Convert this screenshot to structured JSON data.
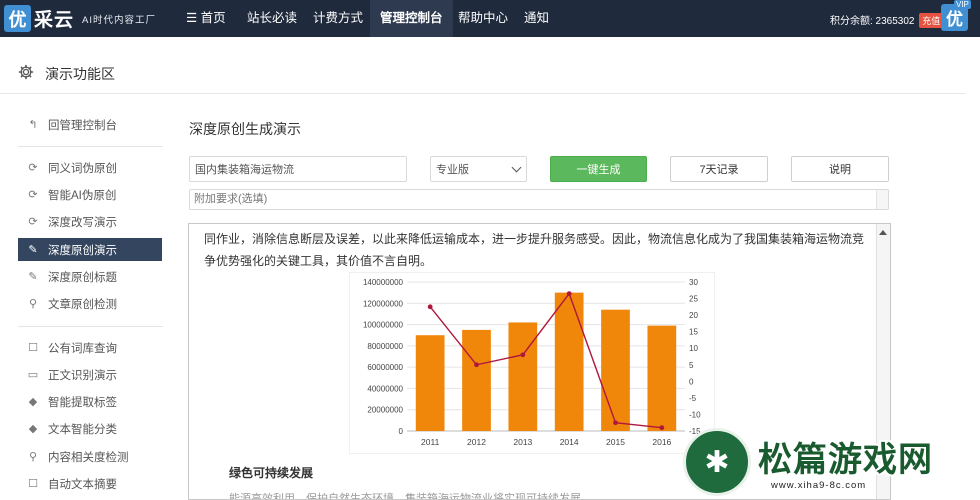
{
  "app": {
    "logo_char": "优",
    "logo_name": "采云",
    "slogan": "AI时代内容工厂"
  },
  "nav": [
    {
      "label": "☰ 首页",
      "active": false
    },
    {
      "label": "站长必读",
      "active": false
    },
    {
      "label": "计费方式",
      "active": false
    },
    {
      "label": "管理控制台",
      "active": true
    },
    {
      "label": "帮助中心",
      "active": false
    },
    {
      "label": "通知",
      "active": false
    }
  ],
  "account": {
    "balance_text": "积分余额: 2365302",
    "recharge_label": "充值",
    "avatar_char": "优",
    "vip_label": "VIP"
  },
  "page": {
    "title": "演示功能区"
  },
  "sidebar": {
    "items": [
      {
        "label": "回管理控制台",
        "icon": "↰",
        "icon_name": "back-icon"
      },
      {
        "label": "同义词伪原创",
        "icon": "⟳",
        "icon_name": "refresh-icon"
      },
      {
        "label": "智能AI伪原创",
        "icon": "⟳",
        "icon_name": "refresh-icon"
      },
      {
        "label": "深度改写演示",
        "icon": "⟳",
        "icon_name": "refresh-icon"
      },
      {
        "label": "深度原创演示",
        "icon": "✎",
        "icon_name": "edit-icon"
      },
      {
        "label": "深度原创标题",
        "icon": "✎",
        "icon_name": "edit-icon"
      },
      {
        "label": "文章原创检测",
        "icon": "⚲",
        "icon_name": "search-icon"
      },
      {
        "label": "公有词库查询",
        "icon": "☐",
        "icon_name": "book-icon"
      },
      {
        "label": "正文识别演示",
        "icon": "▭",
        "icon_name": "monitor-icon"
      },
      {
        "label": "智能提取标签",
        "icon": "◆",
        "icon_name": "tag-icon"
      },
      {
        "label": "文本智能分类",
        "icon": "◆",
        "icon_name": "tag-icon"
      },
      {
        "label": "内容相关度检测",
        "icon": "⚲",
        "icon_name": "search-icon"
      },
      {
        "label": "自动文本摘要",
        "icon": "☐",
        "icon_name": "document-icon"
      }
    ]
  },
  "main": {
    "title": "深度原创生成演示",
    "keyword_value": "国内集装箱海运物流",
    "edition_value": "专业版",
    "generate_label": "一键生成",
    "history_label": "7天记录",
    "help_label": "说明",
    "extra_placeholder": "附加要求(选填)",
    "paragraph": "同作业，消除信息断层及误差，以此来降低运输成本，进一步提升服务感受。因此，物流信息化成为了我国集装箱海运物流竞争优势强化的关键工具，其价值不言自明。",
    "subheading": "绿色可持续发展",
    "faded_line": "能源高效利用，保护自然生态环境，集装箱海运物流业将实现可持续发展。"
  },
  "chart_data": {
    "type": "bar",
    "categories": [
      "2011",
      "2012",
      "2013",
      "2014",
      "2015",
      "2016"
    ],
    "series": [
      {
        "type": "bar",
        "axis": "left",
        "color": "#f0870a",
        "values": [
          90000000,
          95000000,
          102000000,
          130000000,
          114000000,
          99000000
        ]
      },
      {
        "type": "line",
        "axis": "right",
        "color": "#b0173c",
        "values": [
          22.5,
          5,
          8,
          26.5,
          -12.5,
          -14
        ]
      }
    ],
    "y_left": {
      "min": 0,
      "max": 140000000,
      "ticks": [
        "140000000",
        "120000000",
        "100000000",
        "80000000",
        "60000000",
        "40000000",
        "20000000",
        "0"
      ]
    },
    "y_right": {
      "min": -15,
      "max": 30,
      "ticks": [
        "30",
        "25",
        "20",
        "15",
        "10",
        "5",
        "0",
        "-5",
        "-10",
        "-15"
      ]
    },
    "grid": true
  },
  "watermark": {
    "text": "松篇游戏网",
    "url": "www.xiha9-8c.com"
  }
}
